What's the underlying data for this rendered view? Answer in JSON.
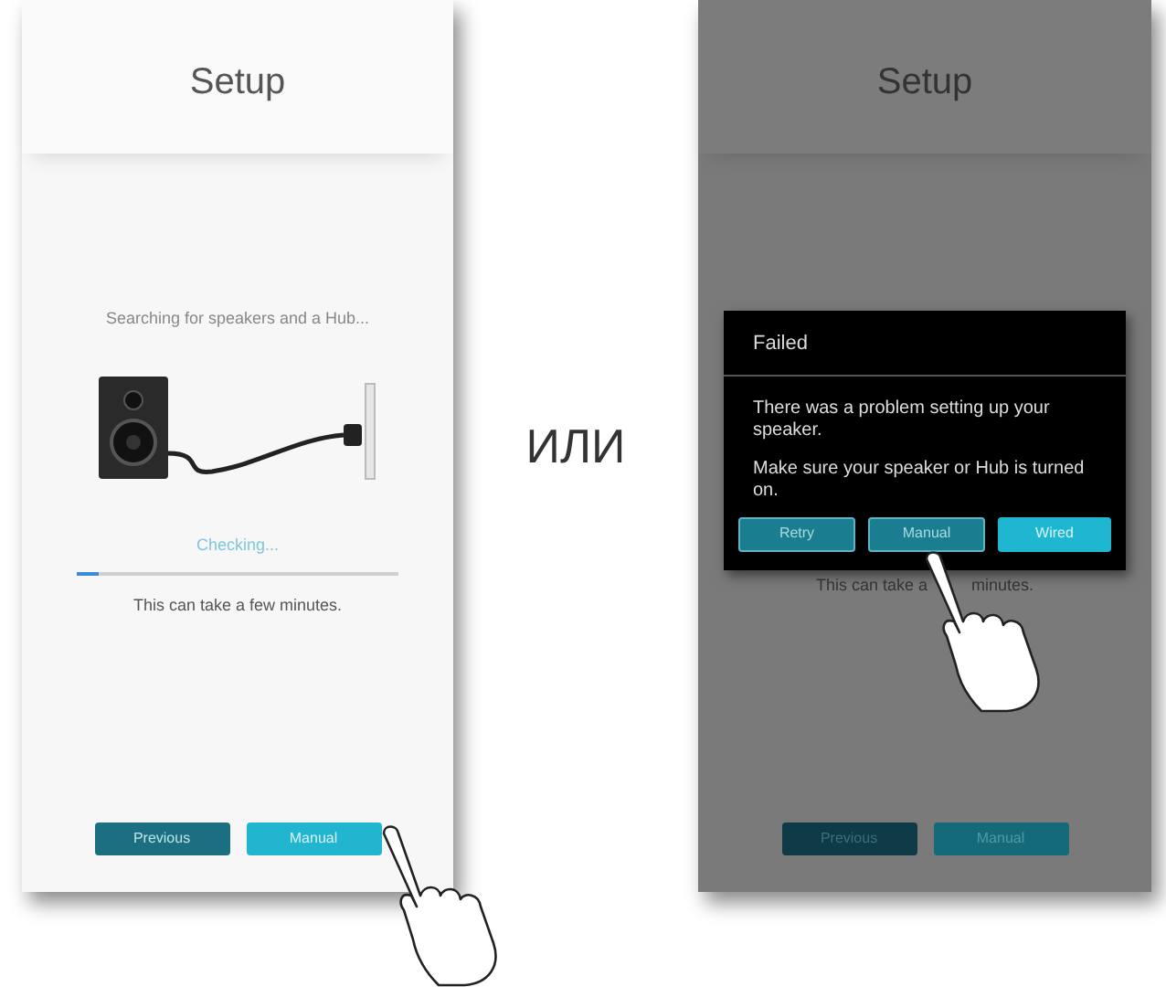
{
  "screens": [
    {
      "kind": "progress",
      "title": "Setup",
      "status": "Searching for speakers and a Hub...",
      "checking": "Checking...",
      "progress": {
        "level": 0.07
      },
      "note": "This can take a few minutes.",
      "buttons": [
        {
          "label": "Previous",
          "kind": "secondary"
        },
        {
          "label": "Manual",
          "kind": "primary"
        }
      ]
    },
    {
      "kind": "failed",
      "title": "Setup",
      "note_parts": [
        "This can take a",
        "minutes."
      ],
      "buttons": [
        {
          "label": "Previous",
          "kind": "secondary"
        },
        {
          "label": "Manual",
          "kind": "primary"
        }
      ],
      "dialog": {
        "title": "Failed",
        "messages": [
          "There was a problem setting up your speaker.",
          "Make sure your speaker or Hub is turned on."
        ],
        "buttons": [
          {
            "label": "Retry",
            "kind": "secondary"
          },
          {
            "label": "Manual",
            "kind": "secondary"
          },
          {
            "label": "Wired",
            "kind": "primary"
          }
        ]
      }
    }
  ],
  "separator": "ИЛИ"
}
